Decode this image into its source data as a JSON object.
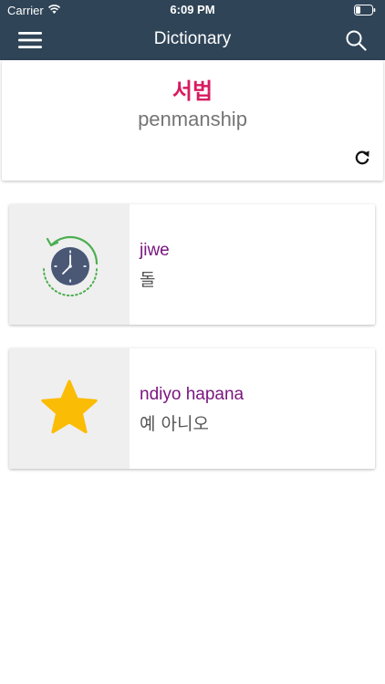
{
  "status_bar": {
    "carrier": "Carrier",
    "time": "6:09 PM",
    "wifi_icon": "wifi-icon",
    "battery_icon": "battery-icon"
  },
  "nav_bar": {
    "title": "Dictionary",
    "menu_icon": "hamburger-menu-icon",
    "search_icon": "search-icon",
    "background_color": "#2f4457"
  },
  "word_of_day": {
    "korean": "서법",
    "english": "penmanship",
    "refresh_icon": "refresh-icon",
    "korean_color": "#d81b60"
  },
  "cards": [
    {
      "icon": "history-clock-icon",
      "primary": "jiwe",
      "secondary": "돌"
    },
    {
      "icon": "star-icon",
      "primary": "ndiyo hapana",
      "secondary": "예 아니오"
    }
  ],
  "colors": {
    "primary_text": "#7b1680",
    "star": "#fbbc05",
    "clock_face": "#4a5876",
    "clock_arrow": "#4caf50"
  }
}
